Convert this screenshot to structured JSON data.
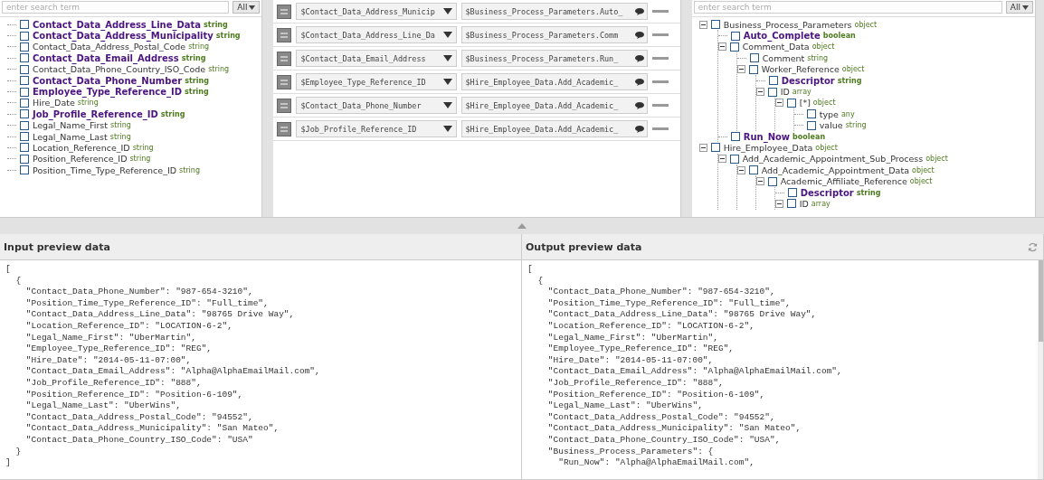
{
  "left_panel": {
    "search": {
      "placeholder": "enter search term"
    },
    "filter": "All",
    "items": [
      {
        "name": "Contact_Data_Address_Line_Data",
        "type": "string",
        "mapped": true,
        "checked": false
      },
      {
        "name": "Contact_Data_Address_Municipality",
        "type": "string",
        "mapped": true,
        "checked": false
      },
      {
        "name": "Contact_Data_Address_Postal_Code",
        "type": "string",
        "mapped": false,
        "checked": false
      },
      {
        "name": "Contact_Data_Email_Address",
        "type": "string",
        "mapped": true,
        "checked": false
      },
      {
        "name": "Contact_Data_Phone_Country_ISO_Code",
        "type": "string",
        "mapped": false,
        "checked": false
      },
      {
        "name": "Contact_Data_Phone_Number",
        "type": "string",
        "mapped": true,
        "checked": false
      },
      {
        "name": "Employee_Type_Reference_ID",
        "type": "string",
        "mapped": true,
        "checked": false
      },
      {
        "name": "Hire_Date",
        "type": "string",
        "mapped": false,
        "checked": false
      },
      {
        "name": "Job_Profile_Reference_ID",
        "type": "string",
        "mapped": true,
        "checked": false
      },
      {
        "name": "Legal_Name_First",
        "type": "string",
        "mapped": false,
        "checked": false
      },
      {
        "name": "Legal_Name_Last",
        "type": "string",
        "mapped": false,
        "checked": false
      },
      {
        "name": "Location_Reference_ID",
        "type": "string",
        "mapped": false,
        "checked": false
      },
      {
        "name": "Position_Reference_ID",
        "type": "string",
        "mapped": false,
        "checked": false
      },
      {
        "name": "Position_Time_Type_Reference_ID",
        "type": "string",
        "mapped": false,
        "checked": false
      }
    ]
  },
  "mappings": [
    {
      "source": "$Contact_Data_Address_Municip",
      "target": "$Business_Process_Parameters.Auto_"
    },
    {
      "source": "$Contact_Data_Address_Line_Da",
      "target": "$Business_Process_Parameters.Comm"
    },
    {
      "source": "$Contact_Data_Email_Address",
      "target": "$Business_Process_Parameters.Run_"
    },
    {
      "source": "$Employee_Type_Reference_ID",
      "target": "$Hire_Employee_Data.Add_Academic_"
    },
    {
      "source": "$Contact_Data_Phone_Number",
      "target": "$Hire_Employee_Data.Add_Academic_"
    },
    {
      "source": "$Job_Profile_Reference_ID",
      "target": "$Hire_Employee_Data.Add_Academic_"
    }
  ],
  "right_panel": {
    "search": {
      "placeholder": "enter search term"
    },
    "filter": "All",
    "tree": [
      {
        "name": "Business_Process_Parameters",
        "type": "object",
        "mapped": false,
        "checked": false,
        "expanded": true,
        "children": [
          {
            "name": "Auto_Complete",
            "type": "boolean",
            "mapped": true,
            "checked": false
          },
          {
            "name": "Comment_Data",
            "type": "object",
            "mapped": false,
            "checked": false,
            "expanded": true,
            "children": [
              {
                "name": "Comment",
                "type": "string",
                "mapped": false,
                "checked": false
              },
              {
                "name": "Worker_Reference",
                "type": "object",
                "mapped": false,
                "checked": false,
                "expanded": true,
                "children": [
                  {
                    "name": "Descriptor",
                    "type": "string",
                    "mapped": true,
                    "checked": false
                  },
                  {
                    "name": "ID",
                    "type": "array",
                    "mapped": false,
                    "checked": false,
                    "expanded": true,
                    "children": [
                      {
                        "name": "[*]",
                        "type": "object",
                        "mapped": false,
                        "checked": false,
                        "expanded": true,
                        "children": [
                          {
                            "name": "type",
                            "type": "any",
                            "mapped": false,
                            "checked": false
                          },
                          {
                            "name": "value",
                            "type": "string",
                            "mapped": false,
                            "checked": false
                          }
                        ]
                      }
                    ]
                  }
                ]
              }
            ]
          },
          {
            "name": "Run_Now",
            "type": "boolean",
            "mapped": true,
            "checked": false
          }
        ]
      },
      {
        "name": "Hire_Employee_Data",
        "type": "object",
        "mapped": false,
        "checked": false,
        "expanded": true,
        "children": [
          {
            "name": "Add_Academic_Appointment_Sub_Process",
            "type": "object",
            "mapped": false,
            "checked": false,
            "expanded": true,
            "children": [
              {
                "name": "Add_Academic_Appointment_Data",
                "type": "object",
                "mapped": false,
                "checked": false,
                "expanded": true,
                "children": [
                  {
                    "name": "Academic_Affiliate_Reference",
                    "type": "object",
                    "mapped": false,
                    "checked": false,
                    "expanded": true,
                    "children": [
                      {
                        "name": "Descriptor",
                        "type": "string",
                        "mapped": true,
                        "checked": false
                      },
                      {
                        "name": "ID",
                        "type": "array",
                        "mapped": false,
                        "checked": false,
                        "expanded": true
                      }
                    ]
                  }
                ]
              }
            ]
          }
        ]
      }
    ]
  },
  "input_preview": {
    "title": "Input preview data",
    "lines": [
      "[",
      "  {",
      "    \"Contact_Data_Phone_Number\": \"987-654-3210\",",
      "    \"Position_Time_Type_Reference_ID\": \"Full_time\",",
      "    \"Contact_Data_Address_Line_Data\": \"98765 Drive Way\",",
      "    \"Location_Reference_ID\": \"LOCATION-6-2\",",
      "    \"Legal_Name_First\": \"UberMartin\",",
      "    \"Employee_Type_Reference_ID\": \"REG\",",
      "    \"Hire_Date\": \"2014-05-11-07:00\",",
      "    \"Contact_Data_Email_Address\": \"Alpha@AlphaEmailMail.com\",",
      "    \"Job_Profile_Reference_ID\": \"888\",",
      "    \"Position_Reference_ID\": \"Position-6-109\",",
      "    \"Legal_Name_Last\": \"UberWins\",",
      "    \"Contact_Data_Address_Postal_Code\": \"94552\",",
      "    \"Contact_Data_Address_Municipality\": \"San Mateo\",",
      "    \"Contact_Data_Phone_Country_ISO_Code\": \"USA\"",
      "  }",
      "]"
    ]
  },
  "output_preview": {
    "title": "Output preview data",
    "lines": [
      "[",
      "  {",
      "    \"Contact_Data_Phone_Number\": \"987-654-3210\",",
      "    \"Position_Time_Type_Reference_ID\": \"Full_time\",",
      "    \"Contact_Data_Address_Line_Data\": \"98765 Drive Way\",",
      "    \"Location_Reference_ID\": \"LOCATION-6-2\",",
      "    \"Legal_Name_First\": \"UberMartin\",",
      "    \"Employee_Type_Reference_ID\": \"REG\",",
      "    \"Hire_Date\": \"2014-05-11-07:00\",",
      "    \"Contact_Data_Email_Address\": \"Alpha@AlphaEmailMail.com\",",
      "    \"Job_Profile_Reference_ID\": \"888\",",
      "    \"Position_Reference_ID\": \"Position-6-109\",",
      "    \"Legal_Name_Last\": \"UberWins\",",
      "    \"Contact_Data_Address_Postal_Code\": \"94552\",",
      "    \"Contact_Data_Address_Municipality\": \"San Mateo\",",
      "    \"Contact_Data_Phone_Country_ISO_Code\": \"USA\",",
      "    \"Business_Process_Parameters\": {",
      "      \"Run_Now\": \"Alpha@AlphaEmailMail.com\","
    ]
  }
}
